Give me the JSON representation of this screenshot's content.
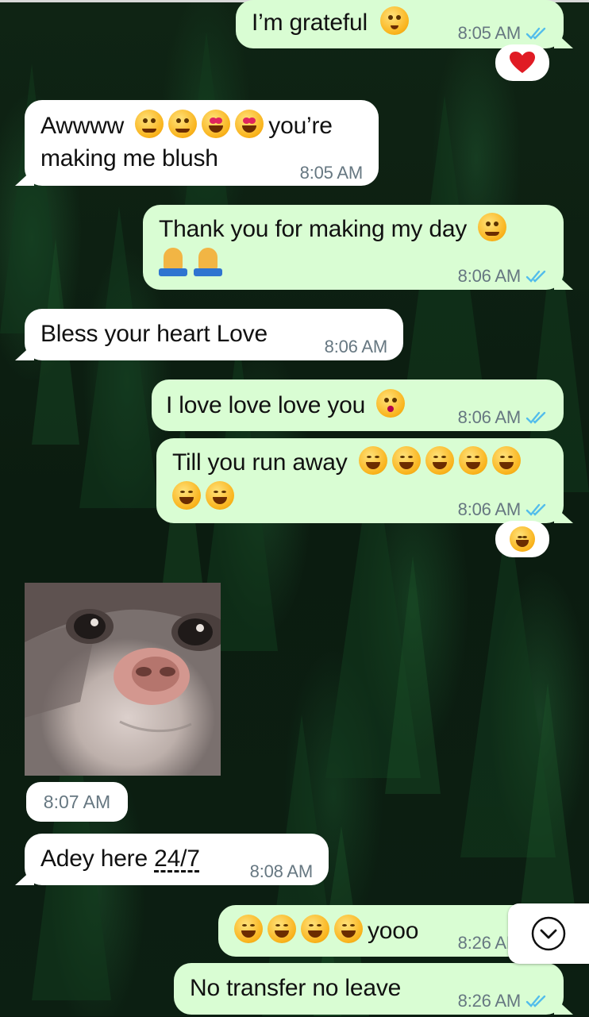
{
  "messages": [
    {
      "text": "I’m grateful",
      "time": "8:05 AM"
    },
    {
      "line1": "Awwww",
      "line1b": "you’re",
      "line2": "making me blush",
      "time": "8:05 AM"
    },
    {
      "line1": "Thank you for making my day",
      "time": "8:06 AM"
    },
    {
      "text": "Bless your heart Love",
      "time": "8:06 AM"
    },
    {
      "text": "I love love love you",
      "time": "8:06 AM"
    },
    {
      "text": "Till you run away",
      "time": "8:06 AM"
    },
    {
      "image_time": "8:07 AM"
    },
    {
      "text_a": "Adey here ",
      "text_b": "24/7",
      "time": "8:08 AM"
    },
    {
      "text": "yooo",
      "time": "8:26 AM"
    },
    {
      "text": "No transfer no leave",
      "time": "8:26 AM"
    }
  ],
  "reactions": [
    "heart",
    "laughing-face"
  ],
  "colors": {
    "outgoing": "#d9fdd3",
    "incoming": "#ffffff",
    "timestamp": "#667781",
    "read_ticks": "#53bdeb"
  }
}
